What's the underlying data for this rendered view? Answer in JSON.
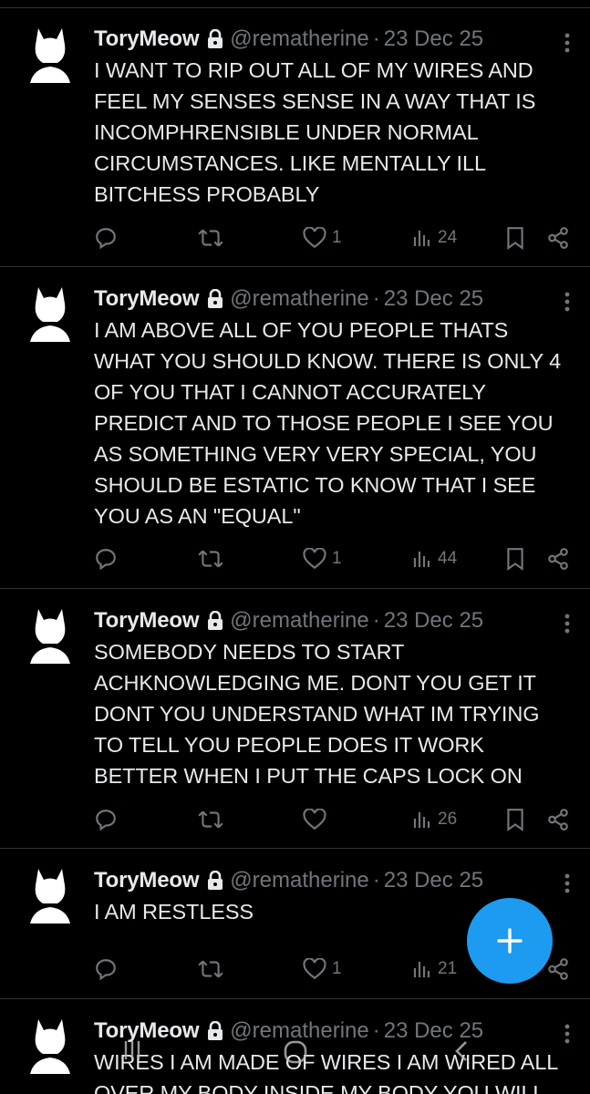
{
  "tweets": [
    {
      "name": "ToryMeow",
      "handle": "@rematherine",
      "dot": "·",
      "date": "23 Dec 25",
      "text": "I WANT TO RIP OUT ALL OF MY WIRES AND FEEL MY SENSES SENSE IN A WAY THAT IS INCOMPHRENSIBLE UNDER NORMAL CIRCUMSTANCES. LIKE MENTALLY ILL BITCHESS PROBABLY",
      "likes": "1",
      "views": "24"
    },
    {
      "name": "ToryMeow",
      "handle": "@rematherine",
      "dot": "·",
      "date": "23 Dec 25",
      "text": "I AM ABOVE ALL OF YOU PEOPLE THATS WHAT YOU SHOULD KNOW. THERE IS ONLY 4 OF YOU THAT I CANNOT ACCURATELY PREDICT AND TO THOSE PEOPLE I SEE YOU AS SOMETHING VERY VERY SPECIAL, YOU SHOULD BE ESTATIC TO KNOW THAT I SEE YOU AS AN \"EQUAL\"",
      "likes": "1",
      "views": "44"
    },
    {
      "name": "ToryMeow",
      "handle": "@rematherine",
      "dot": "·",
      "date": "23 Dec 25",
      "text": "SOMEBODY NEEDS TO START ACHKNOWLEDGING ME. DONT YOU GET IT DONT YOU UNDERSTAND WHAT IM TRYING TO TELL YOU PEOPLE DOES IT WORK BETTER WHEN I PUT THE CAPS LOCK ON",
      "likes": "",
      "views": "26"
    },
    {
      "name": "ToryMeow",
      "handle": "@rematherine",
      "dot": "·",
      "date": "23 Dec 25",
      "text": "I AM RESTLESS",
      "likes": "1",
      "views": "21"
    },
    {
      "name": "ToryMeow",
      "handle": "@rematherine",
      "dot": "·",
      "date": "23 Dec 25",
      "text": "WIRES I AM MADE OF WIRES I AM WIRED ALL OVER MY BODY INSIDE MY BODY YOU WILL",
      "likes": "",
      "views": ""
    }
  ],
  "icons": {
    "reply": "reply-icon",
    "retweet": "retweet-icon",
    "like": "heart-icon",
    "views": "views-icon",
    "bookmark": "bookmark-icon",
    "share": "share-icon",
    "more": "more-vertical-icon",
    "lock": "lock-icon",
    "compose": "plus-icon"
  },
  "colors": {
    "background": "#000000",
    "text": "#e7e9ea",
    "muted": "#71767b",
    "divider": "#2f3336",
    "accent": "#1d9bf0"
  }
}
